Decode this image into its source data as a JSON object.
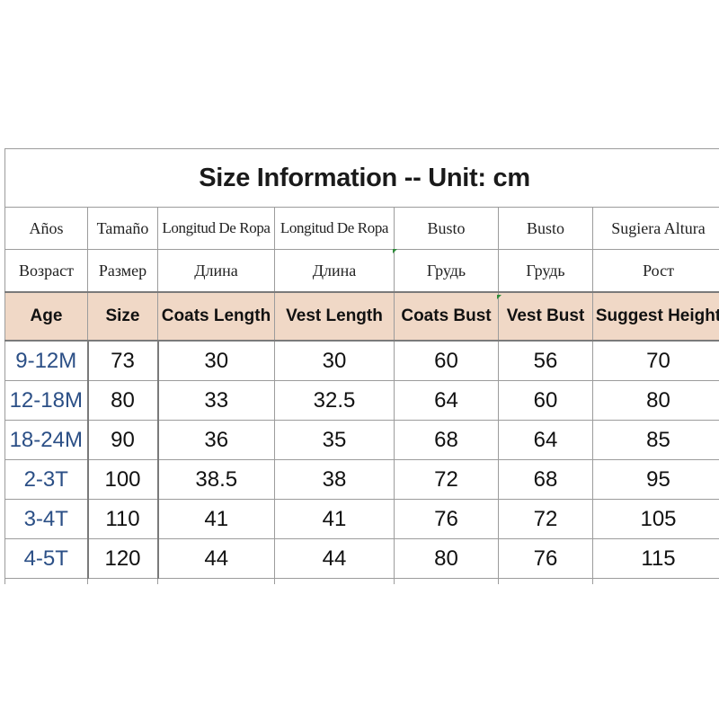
{
  "title": "Size  Information -- Unit: cm",
  "spanish_labels": [
    "Años",
    "Tamaño",
    "Longitud De Ropa",
    "Longitud De Ropa",
    "Busto",
    "Busto",
    "Sugiera Altura"
  ],
  "russian_labels": [
    "Возраст",
    "Размер",
    "Длина",
    "Длина",
    "Грудь",
    "Грудь",
    "Рост"
  ],
  "headers": [
    "Age",
    "Size",
    "Coats Length",
    "Vest Length",
    "Coats Bust",
    "Vest Bust",
    "Suggest Height"
  ],
  "rows": [
    [
      "9-12M",
      "73",
      "30",
      "30",
      "60",
      "56",
      "70"
    ],
    [
      "12-18M",
      "80",
      "33",
      "32.5",
      "64",
      "60",
      "80"
    ],
    [
      "18-24M",
      "90",
      "36",
      "35",
      "68",
      "64",
      "85"
    ],
    [
      "2-3T",
      "100",
      "38.5",
      "38",
      "72",
      "68",
      "95"
    ],
    [
      "3-4T",
      "110",
      "41",
      "41",
      "76",
      "72",
      "105"
    ],
    [
      "4-5T",
      "120",
      "44",
      "44",
      "80",
      "76",
      "115"
    ]
  ],
  "colors": {
    "header_background": "#f0d8c6",
    "age_text": "#2b4f86",
    "grid_line": "#9c9c9c"
  }
}
